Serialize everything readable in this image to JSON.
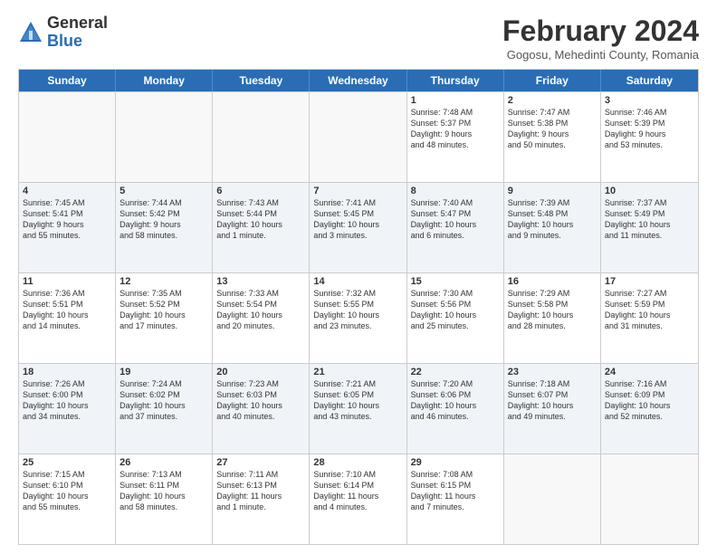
{
  "logo": {
    "general": "General",
    "blue": "Blue"
  },
  "header": {
    "title": "February 2024",
    "subtitle": "Gogosu, Mehedinti County, Romania"
  },
  "days": [
    "Sunday",
    "Monday",
    "Tuesday",
    "Wednesday",
    "Thursday",
    "Friday",
    "Saturday"
  ],
  "weeks": [
    [
      {
        "date": "",
        "info": ""
      },
      {
        "date": "",
        "info": ""
      },
      {
        "date": "",
        "info": ""
      },
      {
        "date": "",
        "info": ""
      },
      {
        "date": "1",
        "info": "Sunrise: 7:48 AM\nSunset: 5:37 PM\nDaylight: 9 hours\nand 48 minutes."
      },
      {
        "date": "2",
        "info": "Sunrise: 7:47 AM\nSunset: 5:38 PM\nDaylight: 9 hours\nand 50 minutes."
      },
      {
        "date": "3",
        "info": "Sunrise: 7:46 AM\nSunset: 5:39 PM\nDaylight: 9 hours\nand 53 minutes."
      }
    ],
    [
      {
        "date": "4",
        "info": "Sunrise: 7:45 AM\nSunset: 5:41 PM\nDaylight: 9 hours\nand 55 minutes."
      },
      {
        "date": "5",
        "info": "Sunrise: 7:44 AM\nSunset: 5:42 PM\nDaylight: 9 hours\nand 58 minutes."
      },
      {
        "date": "6",
        "info": "Sunrise: 7:43 AM\nSunset: 5:44 PM\nDaylight: 10 hours\nand 1 minute."
      },
      {
        "date": "7",
        "info": "Sunrise: 7:41 AM\nSunset: 5:45 PM\nDaylight: 10 hours\nand 3 minutes."
      },
      {
        "date": "8",
        "info": "Sunrise: 7:40 AM\nSunset: 5:47 PM\nDaylight: 10 hours\nand 6 minutes."
      },
      {
        "date": "9",
        "info": "Sunrise: 7:39 AM\nSunset: 5:48 PM\nDaylight: 10 hours\nand 9 minutes."
      },
      {
        "date": "10",
        "info": "Sunrise: 7:37 AM\nSunset: 5:49 PM\nDaylight: 10 hours\nand 11 minutes."
      }
    ],
    [
      {
        "date": "11",
        "info": "Sunrise: 7:36 AM\nSunset: 5:51 PM\nDaylight: 10 hours\nand 14 minutes."
      },
      {
        "date": "12",
        "info": "Sunrise: 7:35 AM\nSunset: 5:52 PM\nDaylight: 10 hours\nand 17 minutes."
      },
      {
        "date": "13",
        "info": "Sunrise: 7:33 AM\nSunset: 5:54 PM\nDaylight: 10 hours\nand 20 minutes."
      },
      {
        "date": "14",
        "info": "Sunrise: 7:32 AM\nSunset: 5:55 PM\nDaylight: 10 hours\nand 23 minutes."
      },
      {
        "date": "15",
        "info": "Sunrise: 7:30 AM\nSunset: 5:56 PM\nDaylight: 10 hours\nand 25 minutes."
      },
      {
        "date": "16",
        "info": "Sunrise: 7:29 AM\nSunset: 5:58 PM\nDaylight: 10 hours\nand 28 minutes."
      },
      {
        "date": "17",
        "info": "Sunrise: 7:27 AM\nSunset: 5:59 PM\nDaylight: 10 hours\nand 31 minutes."
      }
    ],
    [
      {
        "date": "18",
        "info": "Sunrise: 7:26 AM\nSunset: 6:00 PM\nDaylight: 10 hours\nand 34 minutes."
      },
      {
        "date": "19",
        "info": "Sunrise: 7:24 AM\nSunset: 6:02 PM\nDaylight: 10 hours\nand 37 minutes."
      },
      {
        "date": "20",
        "info": "Sunrise: 7:23 AM\nSunset: 6:03 PM\nDaylight: 10 hours\nand 40 minutes."
      },
      {
        "date": "21",
        "info": "Sunrise: 7:21 AM\nSunset: 6:05 PM\nDaylight: 10 hours\nand 43 minutes."
      },
      {
        "date": "22",
        "info": "Sunrise: 7:20 AM\nSunset: 6:06 PM\nDaylight: 10 hours\nand 46 minutes."
      },
      {
        "date": "23",
        "info": "Sunrise: 7:18 AM\nSunset: 6:07 PM\nDaylight: 10 hours\nand 49 minutes."
      },
      {
        "date": "24",
        "info": "Sunrise: 7:16 AM\nSunset: 6:09 PM\nDaylight: 10 hours\nand 52 minutes."
      }
    ],
    [
      {
        "date": "25",
        "info": "Sunrise: 7:15 AM\nSunset: 6:10 PM\nDaylight: 10 hours\nand 55 minutes."
      },
      {
        "date": "26",
        "info": "Sunrise: 7:13 AM\nSunset: 6:11 PM\nDaylight: 10 hours\nand 58 minutes."
      },
      {
        "date": "27",
        "info": "Sunrise: 7:11 AM\nSunset: 6:13 PM\nDaylight: 11 hours\nand 1 minute."
      },
      {
        "date": "28",
        "info": "Sunrise: 7:10 AM\nSunset: 6:14 PM\nDaylight: 11 hours\nand 4 minutes."
      },
      {
        "date": "29",
        "info": "Sunrise: 7:08 AM\nSunset: 6:15 PM\nDaylight: 11 hours\nand 7 minutes."
      },
      {
        "date": "",
        "info": ""
      },
      {
        "date": "",
        "info": ""
      }
    ]
  ]
}
